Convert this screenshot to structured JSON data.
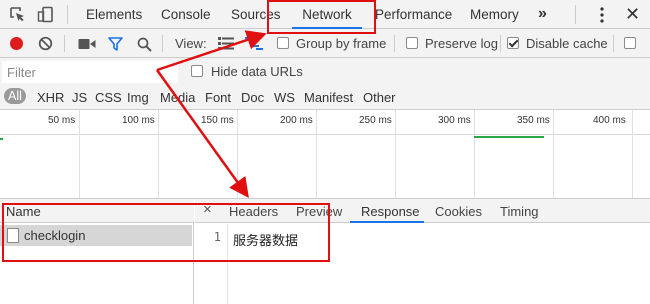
{
  "tabs": {
    "items": [
      "Elements",
      "Console",
      "Sources",
      "Network",
      "Performance",
      "Memory"
    ],
    "overflow": "»",
    "active": "Network"
  },
  "toolbar": {
    "view_label": "View:",
    "group_by_frame": "Group by frame",
    "preserve_log": "Preserve log",
    "disable_cache": "Disable cache",
    "disable_cache_checked": true,
    "record_color": "#e01b1b",
    "filter_icon_color": "#1a73e8"
  },
  "filter": {
    "placeholder": "Filter",
    "hide_data_urls": "Hide data URLs"
  },
  "types": [
    "All",
    "XHR",
    "JS",
    "CSS",
    "Img",
    "Media",
    "Font",
    "Doc",
    "WS",
    "Manifest",
    "Other"
  ],
  "timeline": {
    "ticks": [
      "50 ms",
      "100 ms",
      "150 ms",
      "200 ms",
      "250 ms",
      "300 ms",
      "350 ms",
      "400 ms"
    ]
  },
  "requests": {
    "header": "Name",
    "rows": [
      {
        "name": "checklogin"
      }
    ]
  },
  "detail": {
    "close": "×",
    "tabs": [
      "Headers",
      "Preview",
      "Response",
      "Cookies",
      "Timing"
    ],
    "active_tab": "Response",
    "line_number": "1",
    "response_text": "服务器数据"
  },
  "colors": {
    "annotation": "#e01010",
    "accent": "#1a73e8"
  }
}
